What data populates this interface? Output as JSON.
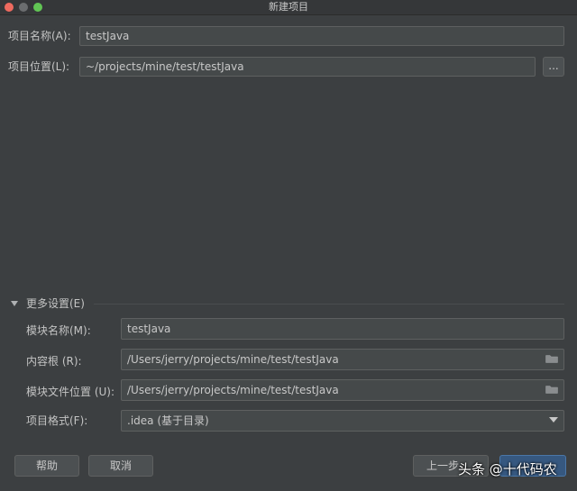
{
  "window": {
    "title": "新建项目"
  },
  "form": {
    "name_label": "项目名称(A):",
    "name_value": "testJava",
    "location_label": "项目位置(L):",
    "location_value": "~/projects/mine/test/testJava",
    "browse_label": "..."
  },
  "more_settings": {
    "label": "更多设置(E)",
    "module_name_label": "模块名称(M):",
    "module_name_value": "testJava",
    "content_root_label": "内容根 (R):",
    "content_root_value": "/Users/jerry/projects/mine/test/testJava",
    "module_file_label": "模块文件位置 (U):",
    "module_file_value": "/Users/jerry/projects/mine/test/testJava",
    "format_label": "项目格式(F):",
    "format_value": ".idea (基于目录)"
  },
  "buttons": {
    "help": "帮助",
    "cancel": "取消",
    "previous": "上一步",
    "finish": ""
  },
  "watermark": "头条 @十代码农",
  "colors": {
    "background": "#3c3f41",
    "field": "#45494a",
    "primary_button": "#365880",
    "traffic_close": "#ee6a5f",
    "traffic_max": "#61c554"
  },
  "icons": [
    "close-traffic-light",
    "minimize-traffic-light",
    "maximize-traffic-light",
    "folder-icon",
    "chevron-down-icon",
    "collapse-triangle-icon"
  ]
}
